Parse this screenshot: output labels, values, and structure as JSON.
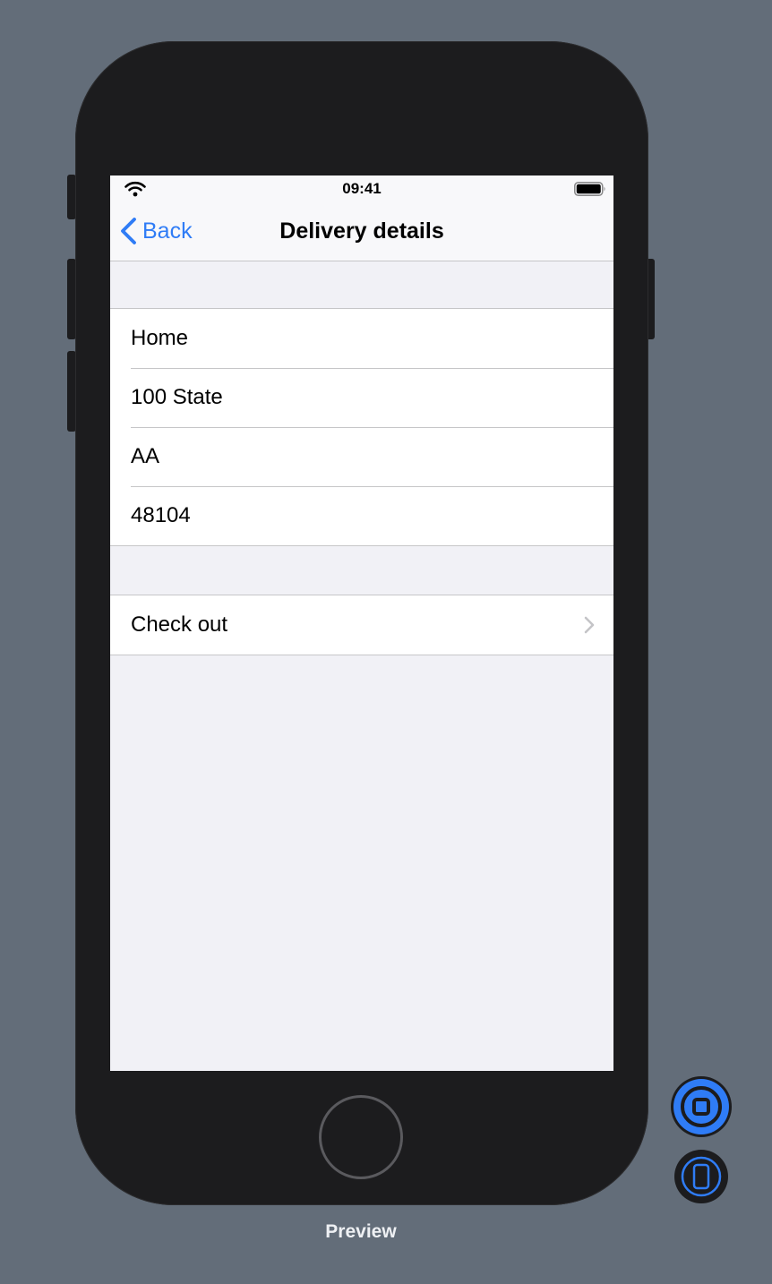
{
  "status_bar": {
    "time": "09:41",
    "icons": [
      "wifi-icon",
      "battery-icon"
    ]
  },
  "nav": {
    "back_label": "Back",
    "title": "Delivery details"
  },
  "address_fields": [
    {
      "value": "Home"
    },
    {
      "value": "100 State"
    },
    {
      "value": "AA"
    },
    {
      "value": "48104"
    }
  ],
  "actions": {
    "checkout_label": "Check out"
  },
  "preview": {
    "label": "Preview"
  },
  "colors": {
    "accent": "#2f7cf6",
    "background": "#636d79",
    "device": "#1c1c1e",
    "grouped_background": "#f1f1f6"
  }
}
